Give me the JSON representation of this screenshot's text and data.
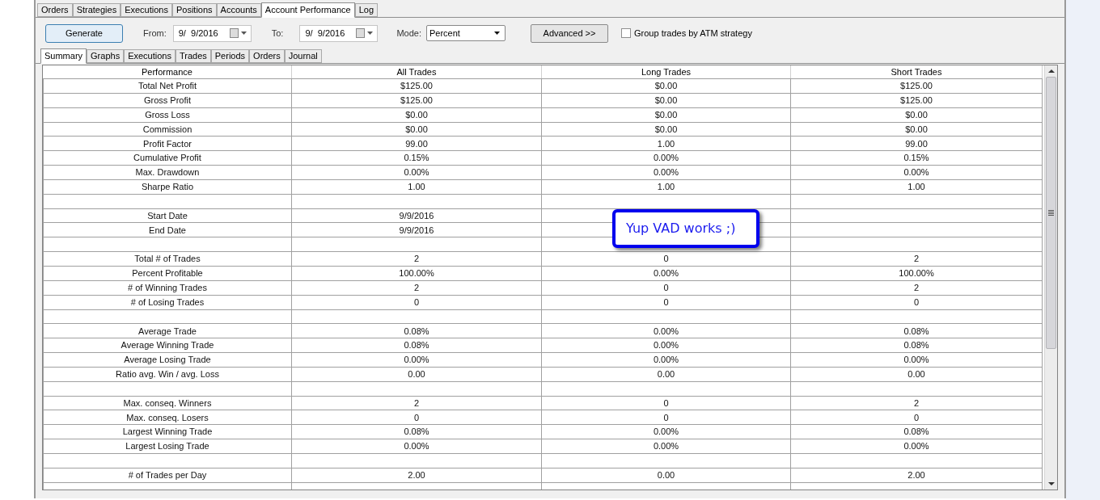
{
  "main_tabs": [
    {
      "label": "Orders",
      "selected": false
    },
    {
      "label": "Strategies",
      "selected": false
    },
    {
      "label": "Executions",
      "selected": false
    },
    {
      "label": "Positions",
      "selected": false
    },
    {
      "label": "Accounts",
      "selected": false
    },
    {
      "label": "Account Performance",
      "selected": true
    },
    {
      "label": "Log",
      "selected": false
    }
  ],
  "toolbar": {
    "generate": "Generate",
    "from_label": "From:",
    "from_value": "9/  9/2016",
    "to_label": "To:",
    "to_value": "9/  9/2016",
    "mode_label": "Mode:",
    "mode_value": "Percent",
    "advanced": "Advanced >>",
    "group_label": "Group trades by ATM strategy",
    "group_checked": false
  },
  "sub_tabs": [
    {
      "label": "Summary",
      "selected": true
    },
    {
      "label": "Graphs",
      "selected": false
    },
    {
      "label": "Executions",
      "selected": false
    },
    {
      "label": "Trades",
      "selected": false
    },
    {
      "label": "Periods",
      "selected": false
    },
    {
      "label": "Orders",
      "selected": false
    },
    {
      "label": "Journal",
      "selected": false
    }
  ],
  "table": {
    "columns": [
      "Performance",
      "All Trades",
      "Long Trades",
      "Short Trades"
    ],
    "rows": [
      {
        "kind": "data",
        "label": "Total Net Profit",
        "all": "$125.00",
        "long": "$0.00",
        "short": "$125.00"
      },
      {
        "kind": "data",
        "label": "Gross Profit",
        "all": "$125.00",
        "long": "$0.00",
        "short": "$125.00"
      },
      {
        "kind": "data",
        "label": "Gross Loss",
        "all": "$0.00",
        "long": "$0.00",
        "short": "$0.00"
      },
      {
        "kind": "data",
        "label": "Commission",
        "all": "$0.00",
        "long": "$0.00",
        "short": "$0.00"
      },
      {
        "kind": "data",
        "label": "Profit Factor",
        "all": "99.00",
        "long": "1.00",
        "short": "99.00"
      },
      {
        "kind": "data",
        "label": "Cumulative Profit",
        "all": "0.15%",
        "long": "0.00%",
        "short": "0.15%"
      },
      {
        "kind": "data",
        "label": "Max. Drawdown",
        "all": "0.00%",
        "long": "0.00%",
        "short": "0.00%"
      },
      {
        "kind": "data",
        "label": "Sharpe Ratio",
        "all": "1.00",
        "long": "1.00",
        "short": "1.00"
      },
      {
        "kind": "blank"
      },
      {
        "kind": "data",
        "label": "Start Date",
        "all": "9/9/2016"
      },
      {
        "kind": "data",
        "label": "End Date",
        "all": "9/9/2016"
      },
      {
        "kind": "blank"
      },
      {
        "kind": "data",
        "label": "Total # of Trades",
        "all": "2",
        "long": "0",
        "short": "2"
      },
      {
        "kind": "data",
        "label": "Percent Profitable",
        "all": "100.00%",
        "long": "0.00%",
        "short": "100.00%"
      },
      {
        "kind": "data",
        "label": "# of Winning Trades",
        "all": "2",
        "long": "0",
        "short": "2"
      },
      {
        "kind": "data",
        "label": "# of Losing Trades",
        "all": "0",
        "long": "0",
        "short": "0"
      },
      {
        "kind": "blank"
      },
      {
        "kind": "data",
        "label": "Average Trade",
        "all": "0.08%",
        "long": "0.00%",
        "short": "0.08%"
      },
      {
        "kind": "data",
        "label": "Average Winning Trade",
        "all": "0.08%",
        "long": "0.00%",
        "short": "0.08%"
      },
      {
        "kind": "data",
        "label": "Average Losing Trade",
        "all": "0.00%",
        "long": "0.00%",
        "short": "0.00%"
      },
      {
        "kind": "data",
        "label": "Ratio avg. Win / avg. Loss",
        "all": "0.00",
        "long": "0.00",
        "short": "0.00"
      },
      {
        "kind": "blank"
      },
      {
        "kind": "data",
        "label": "Max. conseq. Winners",
        "all": "2",
        "long": "0",
        "short": "2"
      },
      {
        "kind": "data",
        "label": "Max. conseq. Losers",
        "all": "0",
        "long": "0",
        "short": "0"
      },
      {
        "kind": "data",
        "label": "Largest Winning Trade",
        "all": "0.08%",
        "long": "0.00%",
        "short": "0.08%"
      },
      {
        "kind": "data",
        "label": "Largest Losing Trade",
        "all": "0.00%",
        "long": "0.00%",
        "short": "0.00%"
      },
      {
        "kind": "blank"
      },
      {
        "kind": "data",
        "label": "# of Trades per Day",
        "all": "2.00",
        "long": "0.00",
        "short": "2.00"
      },
      {
        "kind": "blank"
      }
    ]
  },
  "callout": {
    "text": "Yup VAD works ;)"
  }
}
